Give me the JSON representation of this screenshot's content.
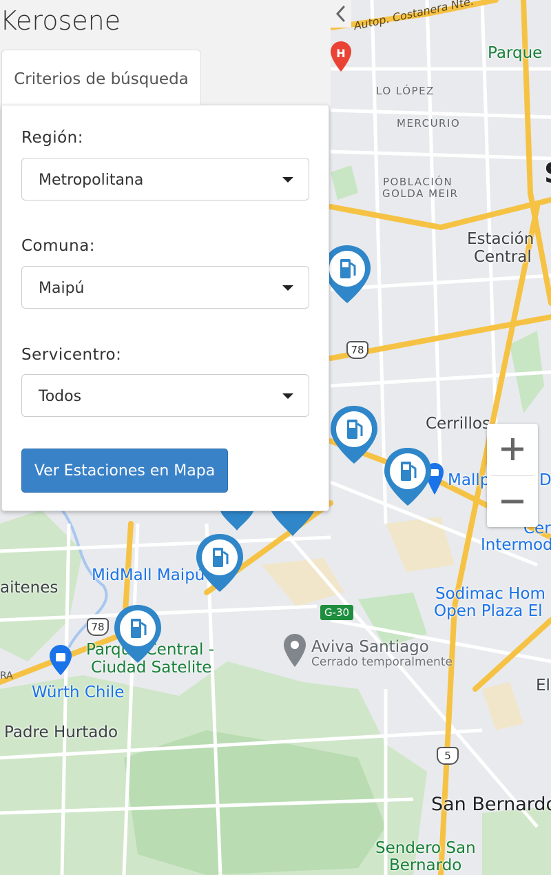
{
  "app": {
    "title": "Kerosene"
  },
  "panel": {
    "tab_label": "Criterios de búsqueda",
    "fields": [
      {
        "label": "Región:",
        "value": "Metropolitana"
      },
      {
        "label": "Comuna:",
        "value": "Maipú"
      },
      {
        "label": "Servicentro:",
        "value": "Todos"
      }
    ],
    "submit_label": "Ver Estaciones en Mapa"
  },
  "map": {
    "zoom_in": "+",
    "zoom_out": "−",
    "labels": {
      "costanera": "Autop. Costanera Nte.",
      "parque": "Parque",
      "lo_lopez": "LO LÓPEZ",
      "mercurio": "MERCURIO",
      "poblacion_1": "POBLACIÓN",
      "poblacion_2": "GOLDA MEIR",
      "estacion_1": "Estación",
      "estacion_2": "Central",
      "route_78a": "78",
      "cerrillos": "Cerrillos",
      "mallplaza": "Mallpl",
      "mallplaza_2": "De",
      "intermod_1": "Cer",
      "intermod_2": "Intermod",
      "midmall": "MidMall Maipú",
      "aitenes": "aitenes",
      "sodimac_1": "Sodimac Hom",
      "sodimac_2": "Open Plaza El",
      "g30": "G-30",
      "route_78b": "78",
      "parque_central_1": "Parque Central -",
      "parque_central_2": "Ciudad Satelite",
      "aviva": "Aviva Santiago",
      "aviva_sub": "Cerrado temporalmente",
      "wurth": "Würth Chile",
      "ra": "RA",
      "el": "El",
      "padre_hurtado": "Padre Hurtado",
      "route_5": "5",
      "san_bernardo": "San Bernardo",
      "sendero_1": "Sendero San",
      "sendero_2": "Bernardo",
      "s_edge": "S"
    }
  },
  "colors": {
    "station_marker": "#2f86c9",
    "button": "#3a82c8",
    "highway": "#f6c244",
    "park": "#c8e6c4"
  }
}
